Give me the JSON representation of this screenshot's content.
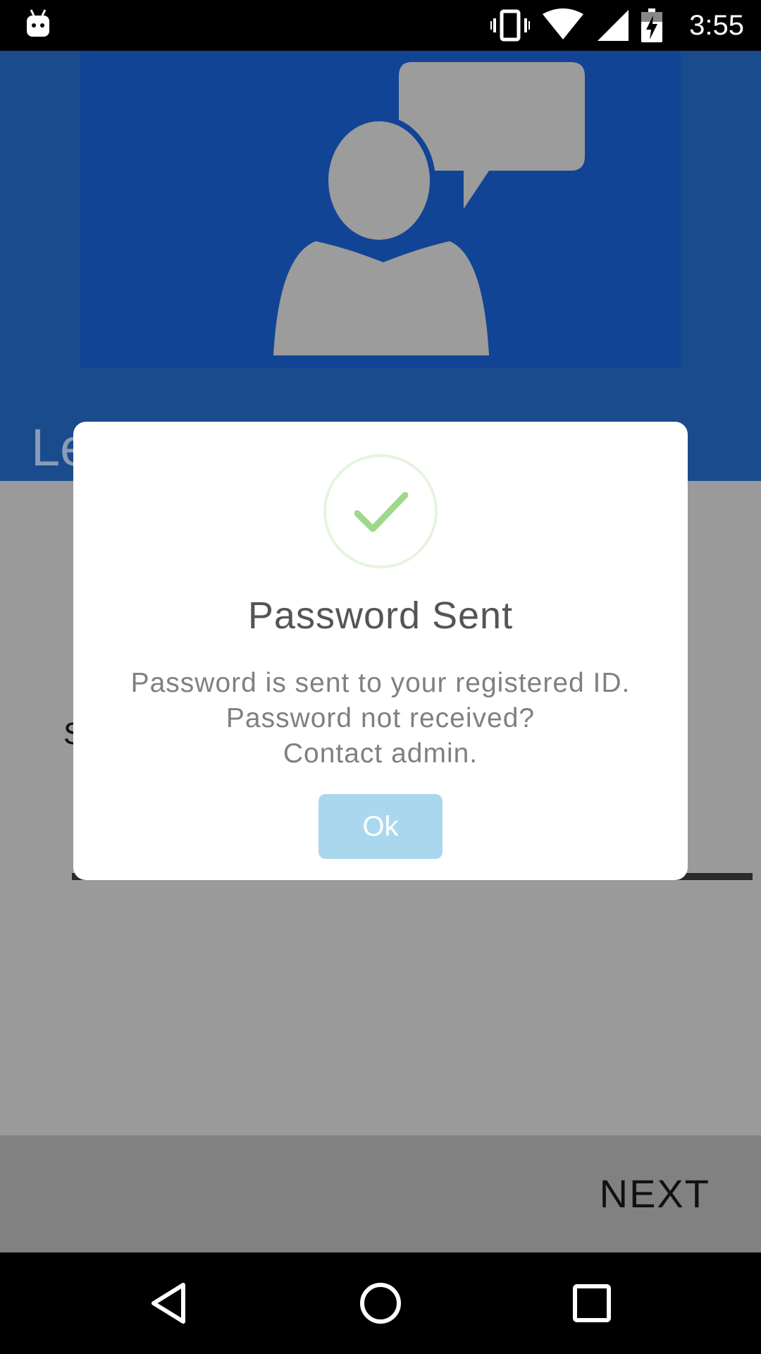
{
  "status_bar": {
    "time": "3:55",
    "icons": [
      "android-icon",
      "vibrate-icon",
      "wifi-icon",
      "signal-icon",
      "battery-charging-icon"
    ]
  },
  "header": {
    "title_partial": "Le"
  },
  "form": {
    "label_partial": "S"
  },
  "action_bar": {
    "next_label": "NEXT"
  },
  "dialog": {
    "icon": "success-check-icon",
    "title": "Password Sent",
    "message_lines": [
      "Password is sent to your registered ID.",
      "Password not received?",
      "Contact admin."
    ],
    "ok_label": "Ok"
  },
  "navbar": {
    "icons": [
      "back-icon",
      "home-icon",
      "recents-icon"
    ]
  },
  "colors": {
    "header_blue": "#1a4b8c",
    "hero_blue": "#124495",
    "scrim_gray": "#9a9a9a",
    "ok_button": "#a9d8ee",
    "check_green": "#9ed88a",
    "ring_green": "#e6f4df"
  }
}
